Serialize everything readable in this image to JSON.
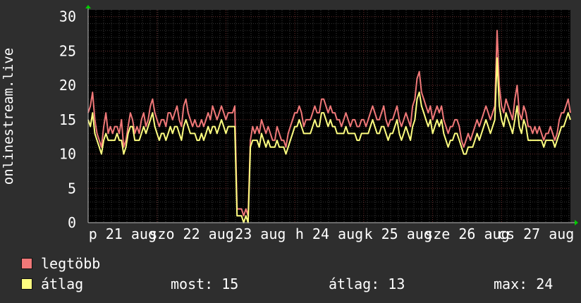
{
  "chart_data": {
    "type": "line",
    "ylabel": "onlinestream.live",
    "ylim": [
      0,
      31
    ],
    "y_ticks": [
      "0",
      "5",
      "10",
      "15",
      "20",
      "25",
      "30"
    ],
    "x_tick_labels": [
      "p 21 aug",
      "szo 22 aug",
      "23 aug",
      "h 24 aug",
      "k 25 aug",
      "sze 26 aug",
      "cs 27 aug"
    ],
    "grid": true,
    "series": [
      {
        "name": "legtöbb",
        "color": "#f07878",
        "values": [
          16,
          17,
          19,
          15,
          13,
          12,
          11,
          14,
          16,
          13,
          14,
          13,
          14,
          14,
          13,
          15,
          11,
          12,
          14,
          16,
          15,
          13,
          14,
          13,
          15,
          16,
          14,
          15,
          17,
          18,
          16,
          15,
          14,
          15,
          15,
          14,
          16,
          16,
          15,
          16,
          17,
          15,
          14,
          17,
          18,
          16,
          15,
          14,
          15,
          14,
          14,
          15,
          14,
          15,
          16,
          15,
          17,
          16,
          15,
          16,
          17,
          16,
          15,
          16,
          16,
          16,
          17,
          2,
          2,
          2,
          1,
          2,
          1,
          12,
          14,
          13,
          14,
          13,
          15,
          14,
          13,
          14,
          13,
          12,
          12,
          14,
          13,
          12,
          12,
          11,
          13,
          14,
          15,
          16,
          16,
          17,
          16,
          14,
          15,
          15,
          15,
          16,
          17,
          16,
          16,
          18,
          18,
          17,
          16,
          17,
          16,
          16,
          15,
          15,
          14,
          15,
          16,
          15,
          14,
          15,
          15,
          14,
          14,
          15,
          15,
          14,
          15,
          16,
          17,
          16,
          15,
          15,
          16,
          17,
          15,
          14,
          15,
          15,
          16,
          17,
          15,
          14,
          15,
          16,
          15,
          14,
          17,
          18,
          21,
          22,
          19,
          18,
          17,
          16,
          17,
          15,
          16,
          17,
          16,
          17,
          15,
          14,
          13,
          14,
          14,
          15,
          15,
          14,
          12,
          11,
          12,
          13,
          12,
          13,
          14,
          15,
          14,
          15,
          16,
          17,
          16,
          15,
          16,
          17,
          28,
          20,
          17,
          16,
          18,
          17,
          16,
          15,
          18,
          20,
          16,
          15,
          17,
          16,
          14,
          14,
          13,
          14,
          13,
          14,
          13,
          12,
          13,
          13,
          14,
          13,
          12,
          13,
          15,
          16,
          16,
          17,
          18,
          16
        ],
        "note": "series extracted from plotted trace"
      },
      {
        "name": "átlag",
        "color": "#ffff80",
        "values": [
          15,
          14,
          16,
          13,
          12,
          11,
          10,
          12,
          13,
          12,
          12,
          12,
          12,
          13,
          12,
          12,
          10,
          11,
          13,
          14,
          14,
          12,
          12,
          12,
          13,
          14,
          13,
          14,
          15,
          16,
          14,
          13,
          12,
          13,
          13,
          12,
          13,
          14,
          13,
          14,
          14,
          13,
          12,
          14,
          15,
          14,
          13,
          13,
          13,
          12,
          12,
          13,
          12,
          13,
          14,
          13,
          14,
          14,
          13,
          14,
          15,
          14,
          13,
          14,
          14,
          14,
          14,
          1,
          1,
          1,
          0,
          1,
          0,
          11,
          12,
          12,
          12,
          11,
          13,
          12,
          11,
          12,
          11,
          11,
          11,
          12,
          11,
          11,
          11,
          10,
          11,
          12,
          13,
          14,
          14,
          15,
          14,
          13,
          13,
          13,
          13,
          14,
          15,
          14,
          14,
          16,
          16,
          15,
          14,
          15,
          14,
          14,
          13,
          13,
          13,
          13,
          14,
          13,
          13,
          13,
          13,
          12,
          12,
          13,
          13,
          13,
          13,
          14,
          15,
          14,
          13,
          13,
          14,
          14,
          13,
          12,
          13,
          13,
          14,
          15,
          13,
          12,
          13,
          14,
          13,
          12,
          14,
          15,
          18,
          19,
          17,
          16,
          15,
          14,
          15,
          13,
          14,
          15,
          14,
          15,
          13,
          12,
          11,
          12,
          12,
          13,
          13,
          12,
          11,
          10,
          10,
          11,
          11,
          11,
          12,
          13,
          12,
          13,
          14,
          15,
          14,
          13,
          14,
          15,
          24,
          17,
          15,
          14,
          16,
          15,
          14,
          13,
          15,
          17,
          14,
          13,
          15,
          14,
          12,
          12,
          12,
          12,
          12,
          12,
          12,
          11,
          12,
          12,
          12,
          12,
          11,
          12,
          13,
          14,
          14,
          15,
          16,
          15
        ],
        "note": "series extracted from plotted trace"
      }
    ]
  },
  "legend": [
    {
      "label": "legtöbb",
      "color": "#f07878"
    },
    {
      "label": "átlag",
      "color": "#ffff80"
    }
  ],
  "stats": {
    "now": "most: 15",
    "avg": "átlag: 13",
    "max": "max: 24"
  }
}
